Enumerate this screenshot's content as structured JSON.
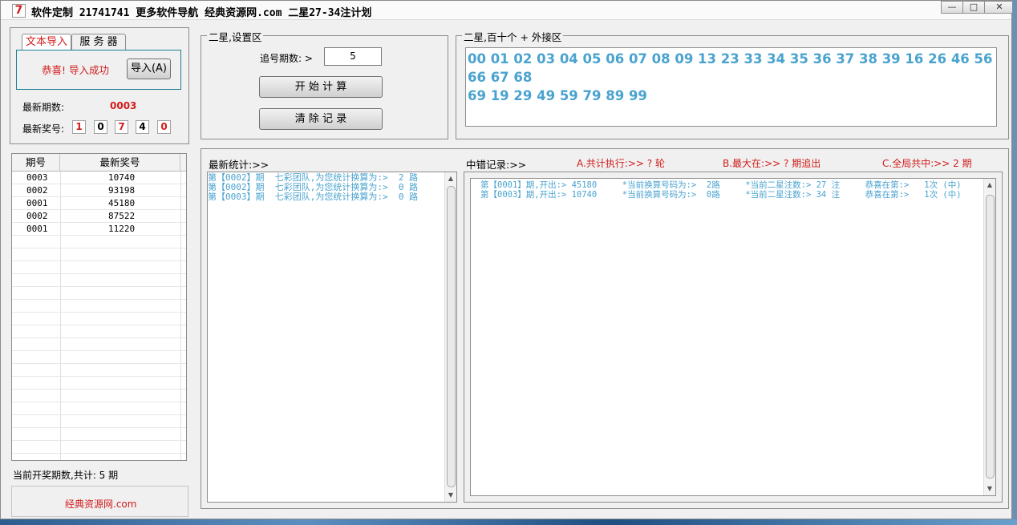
{
  "window": {
    "title": "软件定制 21741741 更多软件导航 经典资源网.com 二星27-34注计划",
    "icon_glyph": "7",
    "minimize_glyph": "—",
    "maximize_glyph": "□",
    "close_glyph": "✕"
  },
  "left_panel": {
    "tabs": [
      {
        "label": "文本导入",
        "active": true
      },
      {
        "label": "服 务 器",
        "active": false
      }
    ],
    "import_message": "恭喜! 导入成功",
    "import_button": "导入(A)",
    "latest_period_label": "最新期数:",
    "latest_period_value": "0003",
    "latest_number_label": "最新奖号:",
    "latest_digits": [
      "1",
      "0",
      "7",
      "4",
      "0"
    ],
    "digit_colors": [
      "#d21c1c",
      "#000000",
      "#d21c1c",
      "#000000",
      "#d21c1c"
    ],
    "table": {
      "headers": [
        "期号",
        "最新奖号"
      ],
      "rows": [
        {
          "period": "0003",
          "number": "10740"
        },
        {
          "period": "0002",
          "number": "93198"
        },
        {
          "period": "0001",
          "number": "45180"
        },
        {
          "period": "0002",
          "number": "87522"
        },
        {
          "period": "0001",
          "number": "11220"
        }
      ]
    },
    "status_text": "当前开奖期数,共计: 5 期",
    "footer_link": "经典资源网.com"
  },
  "settings": {
    "section_title": "二星,设置区",
    "chase_label": "追号期数: >",
    "chase_value": "5",
    "start_button": "开 始 计 算",
    "clear_button": "清 除 记 录"
  },
  "numbers_section": {
    "title": "二星,百十个 + 外接区",
    "line1": "00 01 02 03 04 05 06 07 08 09 13 23 33 34 35 36 37 38 39 16 26 46 56 66 67 68",
    "line2": "69 19 29 49 59 79 89 99"
  },
  "stats": {
    "title": "最新统计:>>",
    "lines": [
      "第【0002】期  七彩团队,为您统计换算为:>  2 路",
      "第【0002】期  七彩团队,为您统计换算为:>  0 路",
      "第【0003】期  七彩团队,为您统计换算为:>  0 路"
    ]
  },
  "records": {
    "title": "中错记录:>>",
    "summary_a": "A.共计执行:>> ? 轮",
    "summary_b": "B.最大在:>> ? 期追出",
    "summary_c": "C.全局共中:>> 2 期",
    "lines": [
      "第【0001】期,开出:> 45180     *当前换算号码为:>  2路     *当前二星注数:> 27 注     恭喜在第:>   1次 (中)",
      "第【0003】期,开出:> 10740     *当前换算号码为:>  0路     *当前二星注数:> 34 注     恭喜在第:>   1次 (中)"
    ]
  },
  "colors": {
    "accent_red": "#d21c1c",
    "number_blue": "#4aa3cf",
    "teal_border": "#1d7f93"
  }
}
